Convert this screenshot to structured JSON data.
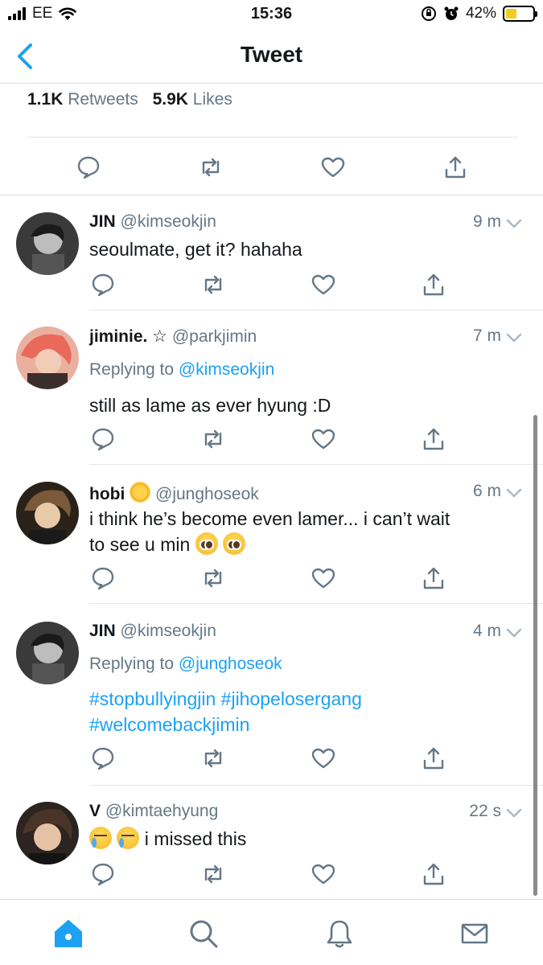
{
  "status_bar": {
    "carrier": "EE",
    "time": "15:36",
    "battery": "42%",
    "battery_level": 0.42
  },
  "header": {
    "title": "Tweet",
    "back_icon": "chevron-left-icon"
  },
  "stats": {
    "retweets_count": "1.1K",
    "retweets_label": "Retweets",
    "likes_count": "5.9K",
    "likes_label": "Likes"
  },
  "replies": [
    {
      "name": "JIN",
      "handle": "@kimseokjin",
      "time": "9 m",
      "text": "seoulmate, get it? hahaha"
    },
    {
      "name": "jiminie. ☆",
      "handle": "@parkjimin",
      "time": "7 m",
      "replying_prefix": "Replying to",
      "replying_to": "@kimseokjin",
      "text": "still as lame as ever hyung :D"
    },
    {
      "name": "hobi",
      "handle": "@junghoseok",
      "time": "6 m",
      "text_line1": "i think he’s become even lamer... i can’t wait",
      "text_line2": "to see u min"
    },
    {
      "name": "JIN",
      "handle": "@kimseokjin",
      "time": "4 m",
      "replying_prefix": "Replying to",
      "replying_to": "@junghoseok",
      "text_line1": "#stopbullyingjin #jihopelosergang",
      "text_line2": "#welcomebackjimin"
    },
    {
      "name": "V",
      "handle": "@kimtaehyung",
      "time": "22 s",
      "text": "i missed this"
    }
  ],
  "tabs": [
    "home-icon",
    "search-icon",
    "notifications-icon",
    "messages-icon"
  ],
  "colors": {
    "accent": "#1da1f2",
    "secondary_text": "#657786",
    "icon_gray": "#657786",
    "home_active": "#1da1f2"
  }
}
